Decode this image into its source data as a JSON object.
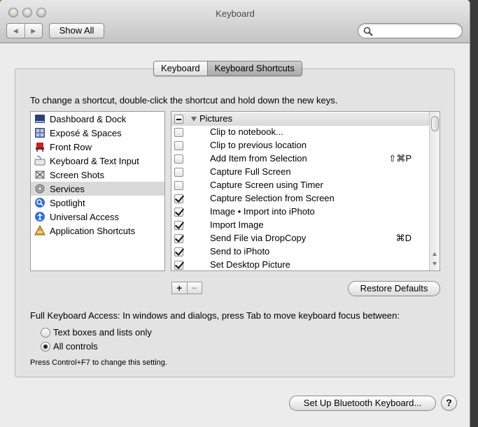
{
  "window": {
    "title": "Keyboard"
  },
  "toolbar": {
    "back_glyph": "◀",
    "forward_glyph": "▶",
    "show_all_label": "Show All",
    "search_placeholder": "",
    "search_value": ""
  },
  "tabs": [
    {
      "label": "Keyboard",
      "active": false
    },
    {
      "label": "Keyboard Shortcuts",
      "active": true
    }
  ],
  "instructions": "To change a shortcut, double-click the shortcut and hold down the new keys.",
  "categories": [
    {
      "label": "Dashboard & Dock",
      "icon": "dashboard-dock-icon",
      "selected": false
    },
    {
      "label": "Exposé & Spaces",
      "icon": "expose-spaces-icon",
      "selected": false
    },
    {
      "label": "Front Row",
      "icon": "front-row-icon",
      "selected": false
    },
    {
      "label": "Keyboard & Text Input",
      "icon": "keyboard-text-icon",
      "selected": false
    },
    {
      "label": "Screen Shots",
      "icon": "screen-shots-icon",
      "selected": false
    },
    {
      "label": "Services",
      "icon": "services-gear-icon",
      "selected": true
    },
    {
      "label": "Spotlight",
      "icon": "spotlight-icon",
      "selected": false
    },
    {
      "label": "Universal Access",
      "icon": "universal-access-icon",
      "selected": false
    },
    {
      "label": "Application Shortcuts",
      "icon": "app-shortcuts-icon",
      "selected": false
    }
  ],
  "shortcuts": {
    "group": {
      "label": "Pictures",
      "state": "mixed"
    },
    "items": [
      {
        "label": "Clip to notebook...",
        "checked": false,
        "key": ""
      },
      {
        "label": "Clip to previous location",
        "checked": false,
        "key": ""
      },
      {
        "label": "Add Item from Selection",
        "checked": false,
        "key": "⇧⌘P"
      },
      {
        "label": "Capture Full Screen",
        "checked": false,
        "key": ""
      },
      {
        "label": "Capture Screen using Timer",
        "checked": false,
        "key": ""
      },
      {
        "label": "Capture Selection from Screen",
        "checked": true,
        "key": ""
      },
      {
        "label": "Image • Import into iPhoto",
        "checked": true,
        "key": ""
      },
      {
        "label": "Import Image",
        "checked": true,
        "key": ""
      },
      {
        "label": "Send File via DropCopy",
        "checked": true,
        "key": "⌘D"
      },
      {
        "label": "Send to iPhoto",
        "checked": true,
        "key": ""
      },
      {
        "label": "Set Desktop Picture",
        "checked": true,
        "key": ""
      }
    ]
  },
  "buttons": {
    "add": "+",
    "remove": "−",
    "restore_defaults": "Restore Defaults",
    "bluetooth": "Set Up Bluetooth Keyboard...",
    "help": "?"
  },
  "full_keyboard_access": {
    "label": "Full Keyboard Access: In windows and dialogs, press Tab to move keyboard focus between:",
    "options": [
      {
        "label": "Text boxes and lists only",
        "selected": false
      },
      {
        "label": "All controls",
        "selected": true
      }
    ],
    "note": "Press Control+F7 to change this setting."
  }
}
